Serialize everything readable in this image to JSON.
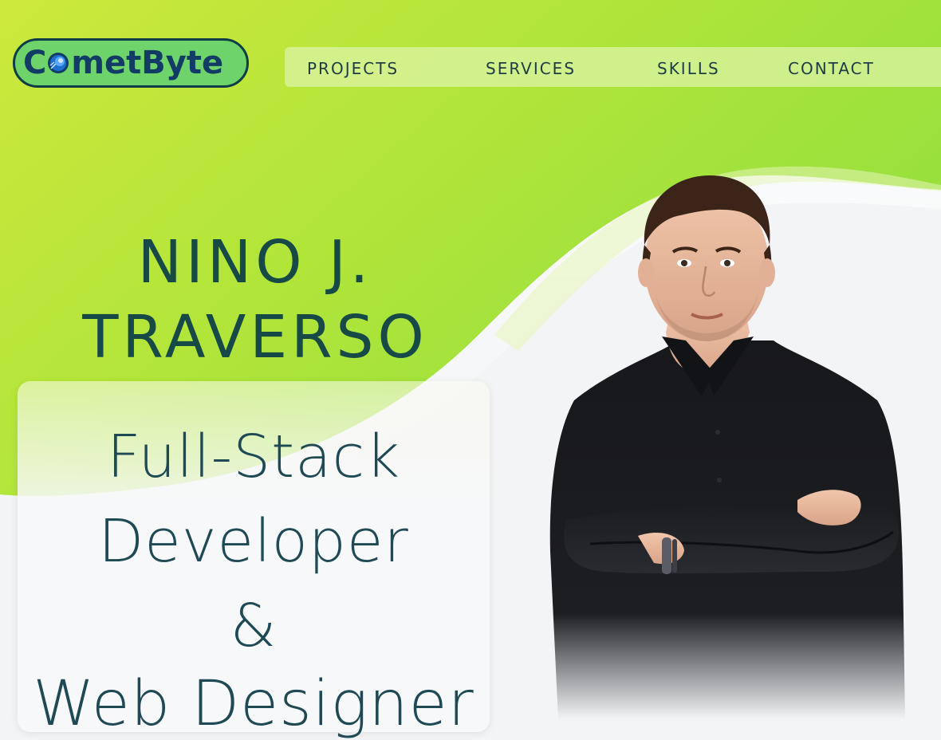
{
  "brand": {
    "logo_text": "CometByte",
    "logo_prefix": "C",
    "logo_suffix": "metByte"
  },
  "nav": {
    "items": [
      {
        "label": "projects"
      },
      {
        "label": "services"
      },
      {
        "label": "skills"
      },
      {
        "label": "contact"
      }
    ]
  },
  "hero": {
    "name_line1": "NINO J.",
    "name_line2": "TRAVERSO",
    "role_line1": "Full-Stack",
    "role_line2": "Developer",
    "role_line3": "&",
    "role_line4": "Web Designer"
  },
  "colors": {
    "accent_green": "#a7e23a",
    "lime": "#cfe83a",
    "text_dark": "#174a47",
    "logo_fill": "#6ed36a",
    "logo_text": "#123c66"
  },
  "icons": {
    "logo": "comet-icon",
    "portrait": "person-portrait"
  }
}
